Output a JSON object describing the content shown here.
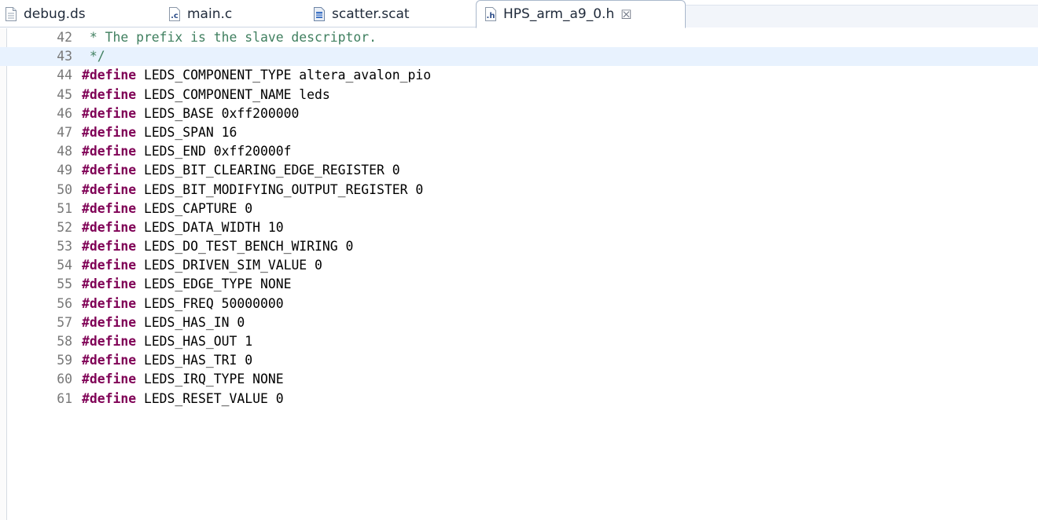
{
  "tabs": [
    {
      "label": "debug.ds",
      "icon": "text-file-icon",
      "active": false
    },
    {
      "label": "main.c",
      "icon": "c-source-file-icon",
      "active": false
    },
    {
      "label": "scatter.scat",
      "icon": "scatter-file-icon",
      "active": false
    },
    {
      "label": "HPS_arm_a9_0.h",
      "icon": "header-file-icon",
      "active": true,
      "close_glyph": "☒"
    }
  ],
  "editor": {
    "current_line": 43,
    "lines": [
      {
        "num": "42",
        "comment": " * The prefix is the slave descriptor."
      },
      {
        "num": "43",
        "comment": " */"
      },
      {
        "num": "44",
        "keyword": "#define",
        "text": " LEDS_COMPONENT_TYPE altera_avalon_pio"
      },
      {
        "num": "45",
        "keyword": "#define",
        "text": " LEDS_COMPONENT_NAME leds"
      },
      {
        "num": "46",
        "keyword": "#define",
        "text": " LEDS_BASE 0xff200000"
      },
      {
        "num": "47",
        "keyword": "#define",
        "text": " LEDS_SPAN 16"
      },
      {
        "num": "48",
        "keyword": "#define",
        "text": " LEDS_END 0xff20000f"
      },
      {
        "num": "49",
        "keyword": "#define",
        "text": " LEDS_BIT_CLEARING_EDGE_REGISTER 0"
      },
      {
        "num": "50",
        "keyword": "#define",
        "text": " LEDS_BIT_MODIFYING_OUTPUT_REGISTER 0"
      },
      {
        "num": "51",
        "keyword": "#define",
        "text": " LEDS_CAPTURE 0"
      },
      {
        "num": "52",
        "keyword": "#define",
        "text": " LEDS_DATA_WIDTH 10"
      },
      {
        "num": "53",
        "keyword": "#define",
        "text": " LEDS_DO_TEST_BENCH_WIRING 0"
      },
      {
        "num": "54",
        "keyword": "#define",
        "text": " LEDS_DRIVEN_SIM_VALUE 0"
      },
      {
        "num": "55",
        "keyword": "#define",
        "text": " LEDS_EDGE_TYPE NONE"
      },
      {
        "num": "56",
        "keyword": "#define",
        "text": " LEDS_FREQ 50000000"
      },
      {
        "num": "57",
        "keyword": "#define",
        "text": " LEDS_HAS_IN 0"
      },
      {
        "num": "58",
        "keyword": "#define",
        "text": " LEDS_HAS_OUT 1"
      },
      {
        "num": "59",
        "keyword": "#define",
        "text": " LEDS_HAS_TRI 0"
      },
      {
        "num": "60",
        "keyword": "#define",
        "text": " LEDS_IRQ_TYPE NONE"
      },
      {
        "num": "61",
        "keyword": "#define",
        "text": " LEDS_RESET_VALUE 0"
      }
    ]
  },
  "colors": {
    "keyword": "#7f0055",
    "comment": "#3f7f5f",
    "line_number": "#787878",
    "current_line_highlight": "#e8f2fe"
  }
}
